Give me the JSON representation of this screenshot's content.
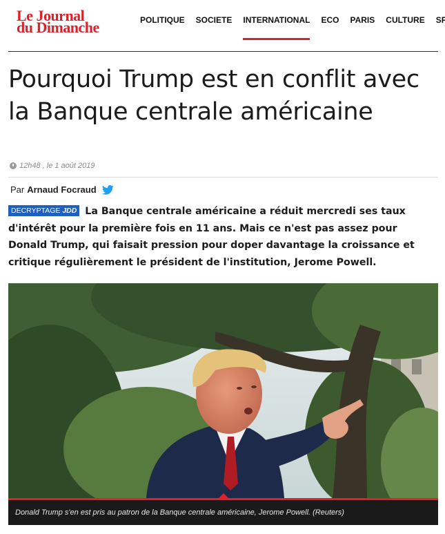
{
  "header": {
    "logo_line1": "Le Journal",
    "logo_line2": "du Dimanche",
    "nav": [
      "POLITIQUE",
      "SOCIETE",
      "INTERNATIONAL",
      "ECO",
      "PARIS",
      "CULTURE",
      "SPO"
    ],
    "active_nav": "INTERNATIONAL",
    "brand_color": "#d8232a"
  },
  "article": {
    "title": "Pourquoi Trump est en conflit avec la Banque centrale américaine",
    "time": "12h48 , le 1 août 2019",
    "byline_prefix": "Par",
    "author": "Arnaud Focraud",
    "badge_label": "DECRYPTAGE",
    "badge_brand": "JDD",
    "lead": "La Banque centrale américaine a réduit mercredi ses taux d'intérêt pour la première fois en 11 ans. Mais ce n'est pas assez pour Donald Trump, qui faisait pression pour doper davantage la croissance et critique régulièrement le président de l'institution, Jerome Powell.",
    "photo_caption": "Donald Trump s'en est pris au patron de la Banque centrale américaine, Jerome Powell. (Reuters)"
  },
  "icons": {
    "clock": "clock-icon",
    "twitter": "twitter-icon"
  }
}
